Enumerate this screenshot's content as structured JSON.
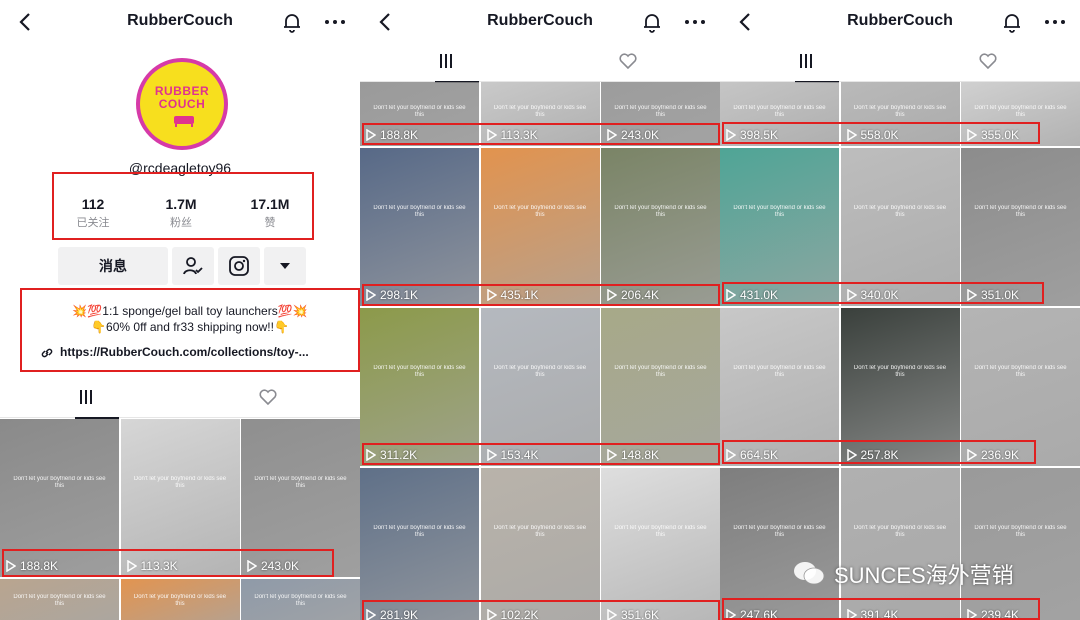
{
  "header": {
    "title": "RubberCouch"
  },
  "profile": {
    "avatar_text_line1": "RUBBER",
    "avatar_text_line2": "COUCH",
    "username": "@rcdeagletoy96",
    "stats": [
      {
        "value": "112",
        "label": "已关注"
      },
      {
        "value": "1.7M",
        "label": "粉丝"
      },
      {
        "value": "17.1M",
        "label": "赞"
      }
    ],
    "message_button": "消息",
    "bio_line1": "💥💯1:1 sponge/gel ball toy launchers💯💥",
    "bio_line2": "👇60% 0ff and fr33 shipping now!!👇",
    "link": "https://RubberCouch.com/collections/toy-..."
  },
  "caption_text": "Don't let your boyfriend or kids see this",
  "panel1_grid": [
    {
      "views": "188.8K",
      "bg": "#8a8a8a"
    },
    {
      "views": "113.3K",
      "bg": "#d6d6d6"
    },
    {
      "views": "243.0K",
      "bg": "#8f8f8f"
    },
    {
      "views": "",
      "bg": "#b9a58f"
    },
    {
      "views": "",
      "bg": "#e29450"
    },
    {
      "views": "",
      "bg": "#8f9aa8"
    }
  ],
  "panel2_grid": [
    {
      "views": "188.8K",
      "bg": "#9a9a9a"
    },
    {
      "views": "113.3K",
      "bg": "#c9c9c9"
    },
    {
      "views": "243.0K",
      "bg": "#9c9c9c"
    },
    {
      "views": "298.1K",
      "bg": "#576987"
    },
    {
      "views": "435.1K",
      "bg": "#e2934e"
    },
    {
      "views": "206.4K",
      "bg": "#7a8466"
    },
    {
      "views": "311.2K",
      "bg": "#8c9a4a"
    },
    {
      "views": "153.4K",
      "bg": "#b5b9bf"
    },
    {
      "views": "148.8K",
      "bg": "#a7a988"
    },
    {
      "views": "281.9K",
      "bg": "#5f7088"
    },
    {
      "views": "102.2K",
      "bg": "#b9b3aa"
    },
    {
      "views": "351.6K",
      "bg": "#dedede"
    }
  ],
  "panel3_grid": [
    {
      "views": "398.5K",
      "bg": "#c5c5c5"
    },
    {
      "views": "558.0K",
      "bg": "#b9b9b9"
    },
    {
      "views": "355.0K",
      "bg": "#d0d0d0"
    },
    {
      "views": "431.0K",
      "bg": "#4fa596"
    },
    {
      "views": "340.0K",
      "bg": "#bdbdbd"
    },
    {
      "views": "351.0K",
      "bg": "#8c8c8c"
    },
    {
      "views": "664.5K",
      "bg": "#c8c8c8"
    },
    {
      "views": "257.8K",
      "bg": "#3a403c"
    },
    {
      "views": "236.9K",
      "bg": "#b4b4b4"
    },
    {
      "views": "247.6K",
      "bg": "#7e7e7e"
    },
    {
      "views": "391.4K",
      "bg": "#b0b0b0"
    },
    {
      "views": "239.4K",
      "bg": "#9a9a9a"
    }
  ],
  "watermark": "SUNCES海外营销",
  "colors": {
    "highlight": "#e02020",
    "avatar_ring": "#d63aa8",
    "avatar_fill": "#f7df1e"
  },
  "icons": [
    "back-icon",
    "bell-icon",
    "more-icon",
    "grid-icon",
    "liked-heart-icon",
    "play-icon",
    "follow-user-icon",
    "instagram-icon",
    "dropdown-icon",
    "link-icon",
    "wechat-icon"
  ]
}
